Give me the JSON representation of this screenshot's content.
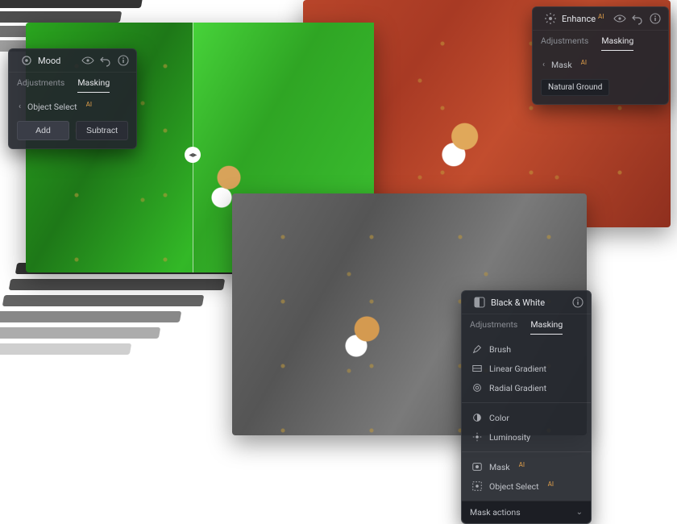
{
  "panels": {
    "mood": {
      "title": "Mood",
      "ai": "AI",
      "tabs": {
        "adjustments": "Adjustments",
        "masking": "Masking"
      },
      "objectSelect": "Object Select",
      "add": "Add",
      "subtract": "Subtract"
    },
    "enhance": {
      "title": "Enhance",
      "ai": "AI",
      "tabs": {
        "adjustments": "Adjustments",
        "masking": "Masking"
      },
      "mask": "Mask",
      "chip": "Natural Ground"
    },
    "bw": {
      "title": "Black & White",
      "tabs": {
        "adjustments": "Adjustments",
        "masking": "Masking"
      },
      "items": {
        "brush": "Brush",
        "linearGradient": "Linear Gradient",
        "radialGradient": "Radial Gradient",
        "color": "Color",
        "luminosity": "Luminosity",
        "mask": "Mask",
        "objectSelect": "Object Select"
      },
      "ai": "AI",
      "maskActions": "Mask actions"
    }
  },
  "colors": {
    "panelBg": "#23262d",
    "accentAI": "#e2a04a"
  }
}
